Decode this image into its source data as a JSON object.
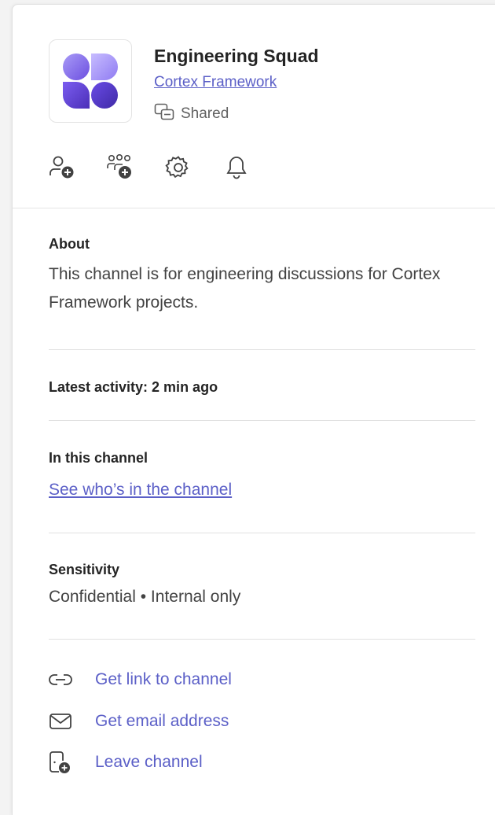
{
  "team": {
    "name": "Engineering Squad",
    "parent": "Cortex Framework",
    "shared_label": "Shared"
  },
  "actions": [
    {
      "icon": "add-member-icon"
    },
    {
      "icon": "add-group-icon"
    },
    {
      "icon": "gear-icon"
    },
    {
      "icon": "bell-icon"
    }
  ],
  "about": {
    "heading": "About",
    "text": "This channel is for engineering discussions for Cortex Framework projects."
  },
  "activity": {
    "heading": "Latest activity: 2 min ago"
  },
  "members": {
    "heading": "In this channel",
    "link": "See who’s in the channel"
  },
  "sensitivity": {
    "heading": "Sensitivity",
    "value": "Confidential • Internal only"
  },
  "links": [
    {
      "icon": "link-icon",
      "label": "Get link to channel"
    },
    {
      "icon": "mail-icon",
      "label": "Get email address"
    },
    {
      "icon": "leave-channel-icon",
      "label": "Leave channel"
    }
  ],
  "colors": {
    "accent": "#5b5fc7",
    "logo_light": "#8b7cf0",
    "logo_dark": "#5a3fc8",
    "text": "#242424",
    "muted": "#616161"
  }
}
